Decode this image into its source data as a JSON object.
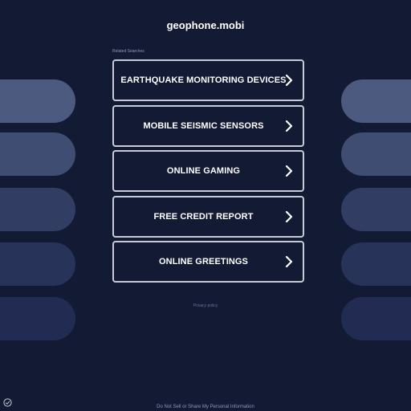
{
  "header": {
    "domain": "geophone.mobi"
  },
  "related": {
    "label": "Related Searches"
  },
  "links": [
    {
      "label": "EARTHQUAKE MONITORING DEVICES"
    },
    {
      "label": "MOBILE SEISMIC SENSORS"
    },
    {
      "label": "ONLINE GAMING"
    },
    {
      "label": "FREE CREDIT REPORT"
    },
    {
      "label": "ONLINE GREETINGS"
    }
  ],
  "privacy": {
    "label": "Privacy policy"
  },
  "footer": {
    "label": "Do Not Sell or Share My Personal Information"
  },
  "colors": {
    "background": "#131a33",
    "button_border": "#c8cbd6",
    "text": "#ffffff"
  },
  "icons": {
    "link_arrow": "chevron-right-icon",
    "corner": "settings-badge-icon"
  }
}
